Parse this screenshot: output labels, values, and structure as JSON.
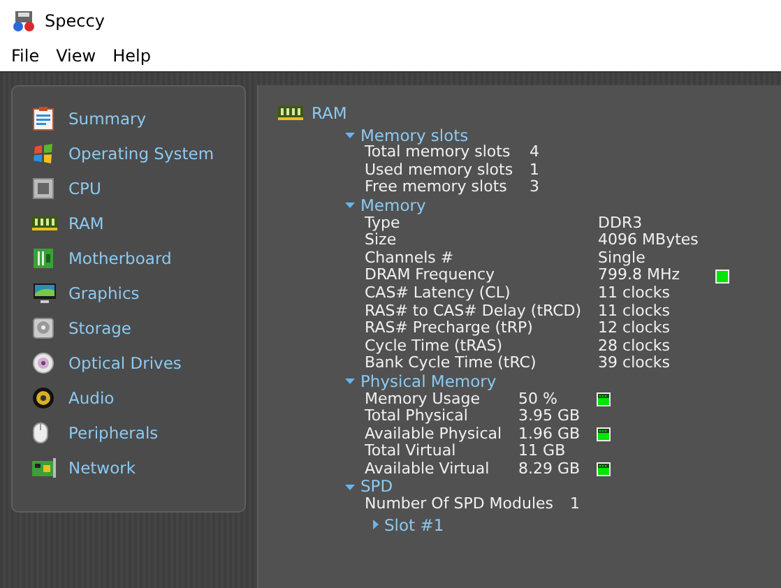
{
  "window": {
    "title": "Speccy"
  },
  "menu": [
    "File",
    "View",
    "Help"
  ],
  "sidebar": {
    "items": [
      {
        "label": "Summary"
      },
      {
        "label": "Operating System"
      },
      {
        "label": "CPU"
      },
      {
        "label": "RAM"
      },
      {
        "label": "Motherboard"
      },
      {
        "label": "Graphics"
      },
      {
        "label": "Storage"
      },
      {
        "label": "Optical Drives"
      },
      {
        "label": "Audio"
      },
      {
        "label": "Peripherals"
      },
      {
        "label": "Network"
      }
    ]
  },
  "content": {
    "title": "RAM",
    "sections": [
      {
        "title": "Memory slots",
        "expanded": true,
        "rows": [
          {
            "label": "Total memory slots",
            "value": "4"
          },
          {
            "label": "Used memory slots",
            "value": "1"
          },
          {
            "label": "Free memory slots",
            "value": "3"
          }
        ]
      },
      {
        "title": "Memory",
        "expanded": true,
        "rows": [
          {
            "label": "Type",
            "value": "DDR3"
          },
          {
            "label": "Size",
            "value": "4096 MBytes"
          },
          {
            "label": "Channels #",
            "value": "Single"
          },
          {
            "label": "DRAM Frequency",
            "value": "799.8 MHz",
            "kind": "status"
          },
          {
            "label": "CAS# Latency (CL)",
            "value": "11 clocks"
          },
          {
            "label": "RAS# to CAS# Delay (tRCD)",
            "value": "11 clocks"
          },
          {
            "label": "RAS# Precharge (tRP)",
            "value": "12 clocks"
          },
          {
            "label": "Cycle Time (tRAS)",
            "value": "28 clocks"
          },
          {
            "label": "Bank Cycle Time (tRC)",
            "value": "39 clocks"
          }
        ]
      },
      {
        "title": "Physical Memory",
        "expanded": true,
        "rows": [
          {
            "label": "Memory Usage",
            "value": "50 %",
            "kind": "meter"
          },
          {
            "label": "Total Physical",
            "value": "3.95 GB"
          },
          {
            "label": "Available Physical",
            "value": "1.96 GB",
            "kind": "meter"
          },
          {
            "label": "Total Virtual",
            "value": "11 GB"
          },
          {
            "label": "Available Virtual",
            "value": "8.29 GB",
            "kind": "meter"
          }
        ]
      },
      {
        "title": "SPD",
        "expanded": true,
        "rows": [
          {
            "label": "Number Of SPD Modules",
            "value": "1"
          }
        ],
        "children": [
          {
            "title": "Slot #1",
            "expanded": false
          }
        ]
      }
    ]
  }
}
